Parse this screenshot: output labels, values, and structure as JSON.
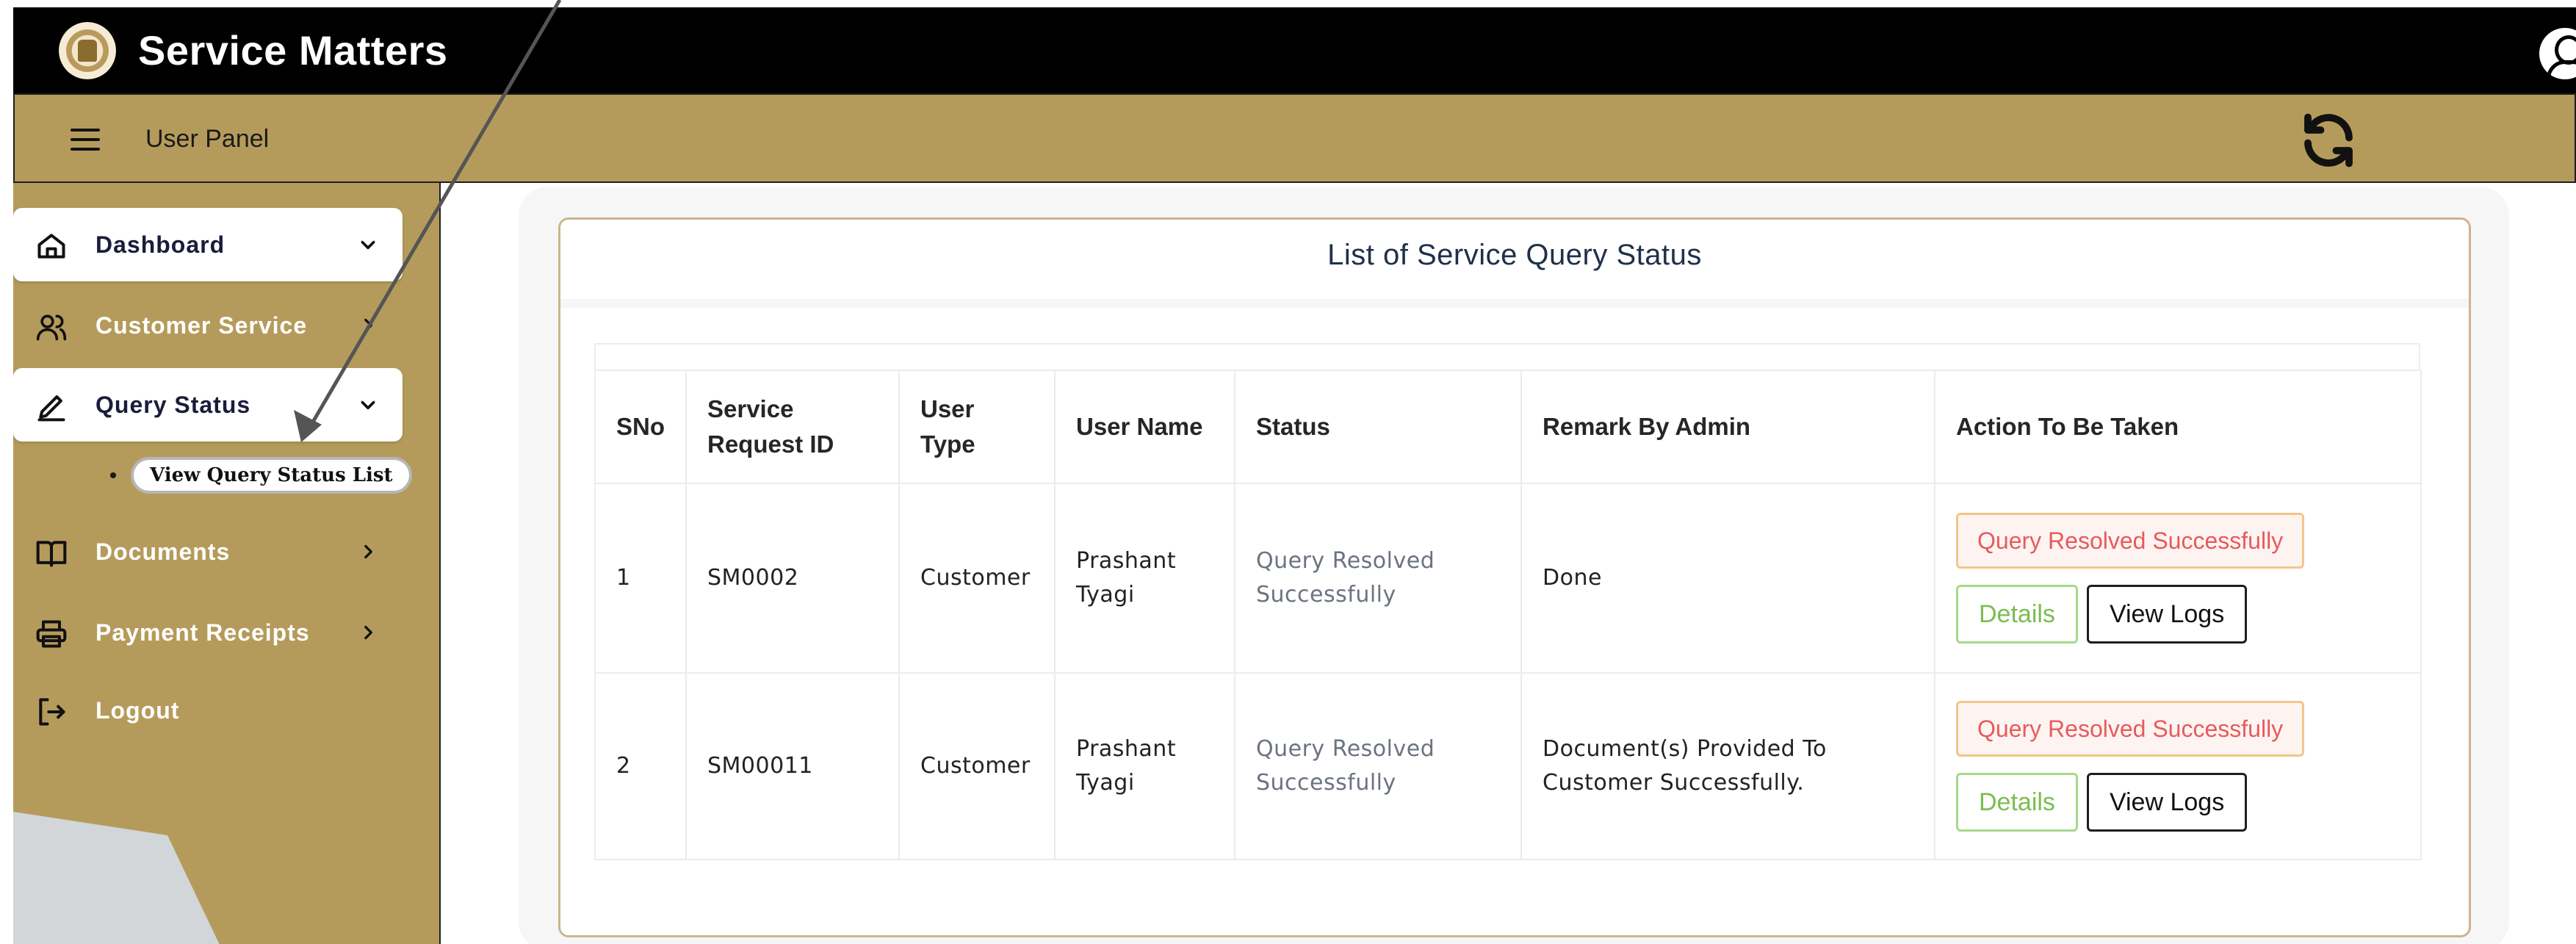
{
  "header": {
    "brand": "Service Matters",
    "logo_icon": "emblem-icon",
    "avatar_icon": "user-avatar-icon"
  },
  "subbar": {
    "label": "User Panel",
    "menu_icon": "hamburger-icon",
    "refresh_icon": "refresh-icon"
  },
  "sidebar": {
    "items": [
      {
        "label": "Dashboard",
        "icon": "home-icon",
        "state": "active"
      },
      {
        "label": "Customer Service",
        "icon": "users-icon",
        "state": "default"
      },
      {
        "label": "Query Status",
        "icon": "pencil-icon",
        "state": "active-expanded"
      },
      {
        "label": "Documents",
        "icon": "book-icon",
        "state": "default"
      },
      {
        "label": "Payment Receipts",
        "icon": "printer-icon",
        "state": "default"
      },
      {
        "label": "Logout",
        "icon": "logout-icon",
        "state": "default"
      }
    ],
    "subitems": [
      {
        "label": "View Query Status List"
      }
    ]
  },
  "main": {
    "title": "List of Service Query Status",
    "columns": [
      "SNo",
      "Service Request ID",
      "User Type",
      "User Name",
      "Status",
      "Remark By Admin",
      "Action To Be Taken"
    ],
    "rows": [
      {
        "sno": "1",
        "request_id": "SM0002",
        "user_type": "Customer",
        "user_name": "Prashant Tyagi",
        "status": "Query Resolved Successfully",
        "remark": "Done",
        "action_status": "Query Resolved Successfully",
        "details_label": "Details",
        "logs_label": "View Logs"
      },
      {
        "sno": "2",
        "request_id": "SM00011",
        "user_type": "Customer",
        "user_name": "Prashant Tyagi",
        "status": "Query Resolved Successfully",
        "remark": "Document(s) Provided To Customer Successfully.",
        "action_status": "Query Resolved Successfully",
        "details_label": "Details",
        "logs_label": "View Logs"
      }
    ]
  },
  "colors": {
    "topbar": "#000000",
    "accent": "#b59b5b",
    "card_border": "#cbb58b",
    "resolved_text": "#e85a5a",
    "details_green": "#7bbd50"
  }
}
